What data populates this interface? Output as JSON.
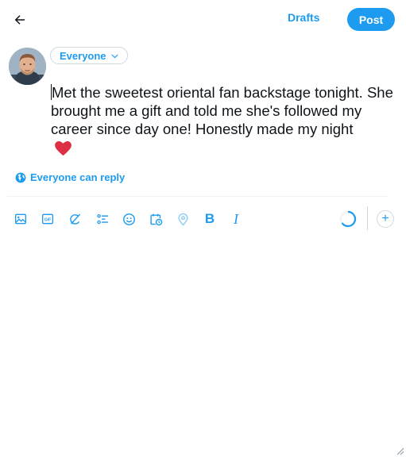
{
  "header": {
    "back_icon": "arrow-left-icon",
    "drafts_label": "Drafts",
    "post_label": "Post"
  },
  "audience": {
    "label": "Everyone",
    "icon": "chevron-down-icon"
  },
  "compose": {
    "text": "Met the sweetest oriental fan backstage tonight. She brought me a gift and told me she's followed my career since day one! Honestly made my night",
    "emoji": "red-heart"
  },
  "reply_setting": {
    "icon": "globe-icon",
    "label": "Everyone can reply"
  },
  "toolbar": {
    "tools": [
      "image-icon",
      "gif-icon",
      "grok-icon",
      "poll-icon",
      "emoji-icon",
      "schedule-icon",
      "location-icon",
      "bold-icon",
      "italic-icon"
    ],
    "bold_label": "B",
    "italic_label": "I",
    "add_label": "+"
  },
  "colors": {
    "accent": "#1d9bf0",
    "text": "#0f1419",
    "border": "#cfd9de"
  }
}
